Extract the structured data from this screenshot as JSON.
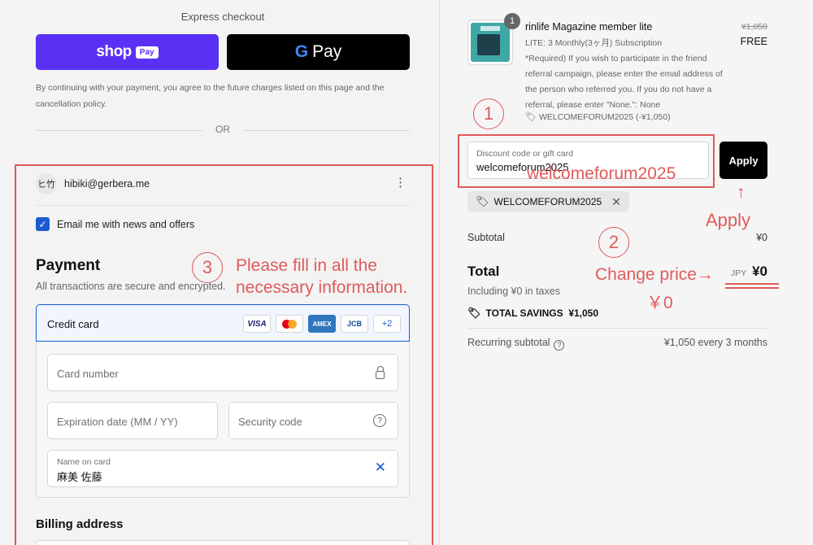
{
  "express": {
    "title": "Express checkout",
    "shop_pay_word": "shop",
    "shop_pay_pill": "Pay",
    "gpay_letter": "G",
    "gpay_word": "Pay",
    "consent": "By continuing with your payment, you agree to the future charges listed on this page and the cancellation policy.",
    "or": "OR"
  },
  "account": {
    "avatar": "ヒ竹",
    "email": "hibiki@gerbera.me",
    "menu_icon": "⋮"
  },
  "newsletter": {
    "checked": true,
    "label": "Email me with news and offers"
  },
  "payment": {
    "title": "Payment",
    "subtitle": "All transactions are secure and encrypted.",
    "method_label": "Credit card",
    "brands": [
      "VISA",
      "AMEX",
      "JCB",
      "+2"
    ],
    "card_number_placeholder": "Card number",
    "expiration_placeholder": "Expiration date (MM / YY)",
    "security_placeholder": "Security code",
    "security_icon": "?",
    "name_label": "Name on card",
    "name_value": "麻美 佐藤",
    "clear_icon": "✕"
  },
  "billing": {
    "title": "Billing address"
  },
  "order": {
    "quantity": "1",
    "product_name": "rinlife Magazine member lite",
    "product_meta": "LITE: 3 Monthly(3ヶ月) Subscription\n*Required) If you wish to participate in the friend referral campaign, please enter the email address of the person who referred you. If you do not have a referral, please enter \"None.\": None",
    "product_discount": "WELCOMEFORUM2025 (-¥1,050)",
    "price_old": "¥1,050",
    "price_new": "FREE",
    "discount_label": "Discount code or gift card",
    "discount_value": "welcomeforum2025",
    "apply": "Apply",
    "chip_code": "WELCOMEFORUM2025",
    "subtotal_label": "Subtotal",
    "subtotal_value": "¥0",
    "total_label": "Total",
    "currency": "JPY",
    "total_value": "¥0",
    "tax_note": "Including ¥0 in taxes",
    "savings_label": "TOTAL SAVINGS",
    "savings_value": "¥1,050",
    "recurring_label": "Recurring subtotal",
    "recurring_value": "¥1,050 every 3 months"
  },
  "annotations": {
    "circle1": "1",
    "circle2": "2",
    "circle3": "3",
    "code_hint": "welcomeforum2025",
    "apply_arrow": "↑",
    "apply_hint": "Apply",
    "change_price": "Change price→",
    "price_zero": "￥0",
    "fill_info_line1": "Please fill in all the",
    "fill_info_line2": "necessary information.",
    "accent_color": "#e05a5a"
  }
}
